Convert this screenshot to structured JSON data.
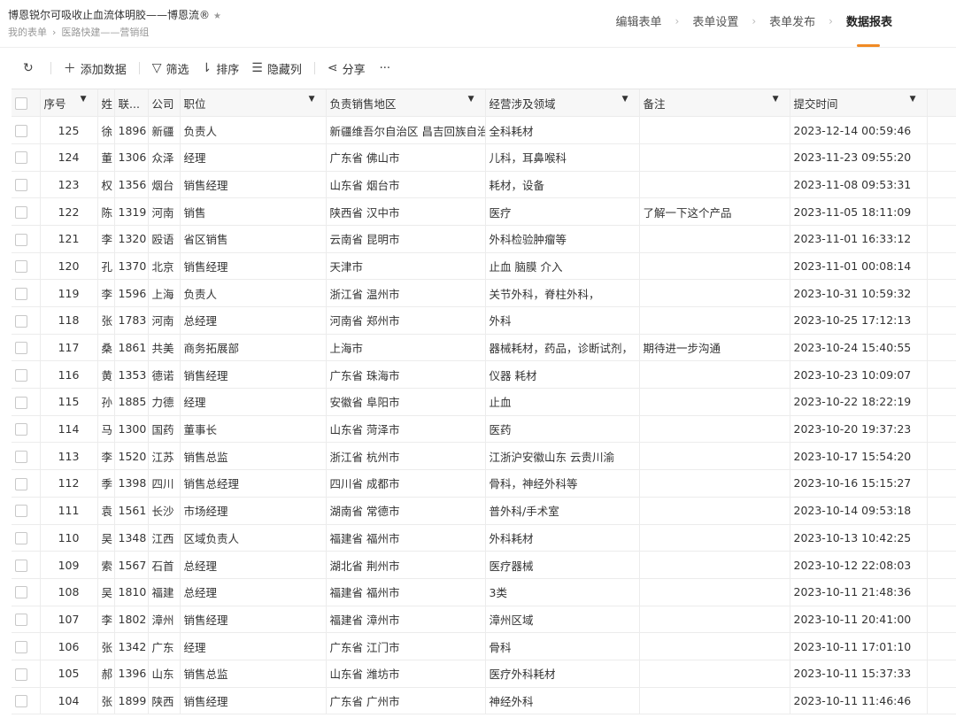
{
  "header": {
    "form_title": "博恩锐尔可吸收止血流体明胶——博恩流®",
    "star_icon": "★",
    "breadcrumb": [
      "我的表单",
      "医路快建——营销组"
    ],
    "steps": [
      "编辑表单",
      "表单设置",
      "表单发布",
      "数据报表"
    ],
    "active_step": 3
  },
  "toolbar": {
    "refresh_icon": "↻",
    "add_label": "添加数据",
    "filter_label": "筛选",
    "sort_label": "排序",
    "hide_cols_label": "隐藏列",
    "share_label": "分享",
    "more_label": "···"
  },
  "table": {
    "columns": [
      "序号",
      "姓",
      "联...",
      "公司",
      "职位",
      "负责销售地区",
      "经营涉及领域",
      "备注",
      "提交时间"
    ],
    "rows": [
      [
        "125",
        "徐",
        "1896",
        "新疆",
        "负责人",
        "新疆维吾尔自治区 昌吉回族自治",
        "全科耗材",
        "",
        "2023-12-14 00:59:46"
      ],
      [
        "124",
        "董",
        "1306",
        "众泽",
        "经理",
        "广东省 佛山市",
        "儿科，耳鼻喉科",
        "",
        "2023-11-23 09:55:20"
      ],
      [
        "123",
        "权",
        "1356",
        "烟台",
        "销售经理",
        "山东省 烟台市",
        "耗材，设备",
        "",
        "2023-11-08 09:53:31"
      ],
      [
        "122",
        "陈",
        "1319",
        "河南",
        "销售",
        "陕西省 汉中市",
        "医疗",
        "了解一下这个产品",
        "2023-11-05 18:11:09"
      ],
      [
        "121",
        "李",
        "1320",
        "殴语",
        "省区销售",
        "云南省 昆明市",
        "外科检验肿瘤等",
        "",
        "2023-11-01 16:33:12"
      ],
      [
        "120",
        "孔",
        "1370",
        "北京",
        "销售经理",
        "天津市",
        "止血 脑膜 介入",
        "",
        "2023-11-01 00:08:14"
      ],
      [
        "119",
        "李",
        "1596",
        "上海",
        "负责人",
        "浙江省 温州市",
        "关节外科，脊柱外科，",
        "",
        "2023-10-31 10:59:32"
      ],
      [
        "118",
        "张",
        "1783",
        "河南",
        "总经理",
        "河南省 郑州市",
        "外科",
        "",
        "2023-10-25 17:12:13"
      ],
      [
        "117",
        "桑",
        "1861",
        "共美",
        "商务拓展部",
        "上海市",
        "器械耗材，药品，诊断试剂，",
        "期待进一步沟通",
        "2023-10-24 15:40:55"
      ],
      [
        "116",
        "黄",
        "1353",
        "德诺",
        "销售经理",
        "广东省 珠海市",
        "仪器 耗材",
        "",
        "2023-10-23 10:09:07"
      ],
      [
        "115",
        "孙",
        "1885",
        "力德",
        "经理",
        "安徽省 阜阳市",
        "止血",
        "",
        "2023-10-22 18:22:19"
      ],
      [
        "114",
        "马",
        "1300",
        "国药",
        "董事长",
        "山东省 菏泽市",
        "医药",
        "",
        "2023-10-20 19:37:23"
      ],
      [
        "113",
        "李",
        "1520",
        "江苏",
        "销售总监",
        "浙江省 杭州市",
        "江浙沪安徽山东 云贵川渝",
        "",
        "2023-10-17 15:54:20"
      ],
      [
        "112",
        "季",
        "1398",
        "四川",
        "销售总经理",
        "四川省 成都市",
        "骨科，神经外科等",
        "",
        "2023-10-16 15:15:27"
      ],
      [
        "111",
        "袁",
        "1561",
        "长沙",
        "市场经理",
        "湖南省 常德市",
        "普外科/手术室",
        "",
        "2023-10-14 09:53:18"
      ],
      [
        "110",
        "吴",
        "1348",
        "江西",
        "区域负责人",
        "福建省 福州市",
        "外科耗材",
        "",
        "2023-10-13 10:42:25"
      ],
      [
        "109",
        "索",
        "1567",
        "石首",
        "总经理",
        "湖北省 荆州市",
        "医疗器械",
        "",
        "2023-10-12 22:08:03"
      ],
      [
        "108",
        "吴",
        "1810",
        "福建",
        "总经理",
        "福建省 福州市",
        "3类",
        "",
        "2023-10-11 21:48:36"
      ],
      [
        "107",
        "李",
        "1802",
        "漳州",
        "销售经理",
        "福建省 漳州市",
        "漳州区域",
        "",
        "2023-10-11 20:41:00"
      ],
      [
        "106",
        "张",
        "1342",
        "广东",
        "经理",
        "广东省 江门市",
        "骨科",
        "",
        "2023-10-11 17:01:10"
      ],
      [
        "105",
        "郝",
        "1396",
        "山东",
        "销售总监",
        "山东省 潍坊市",
        "医疗外科耗材",
        "",
        "2023-10-11 15:37:33"
      ],
      [
        "104",
        "张",
        "1899",
        "陕西",
        "销售经理",
        "广东省 广州市",
        "神经外科",
        "",
        "2023-10-11 11:46:46"
      ]
    ]
  }
}
